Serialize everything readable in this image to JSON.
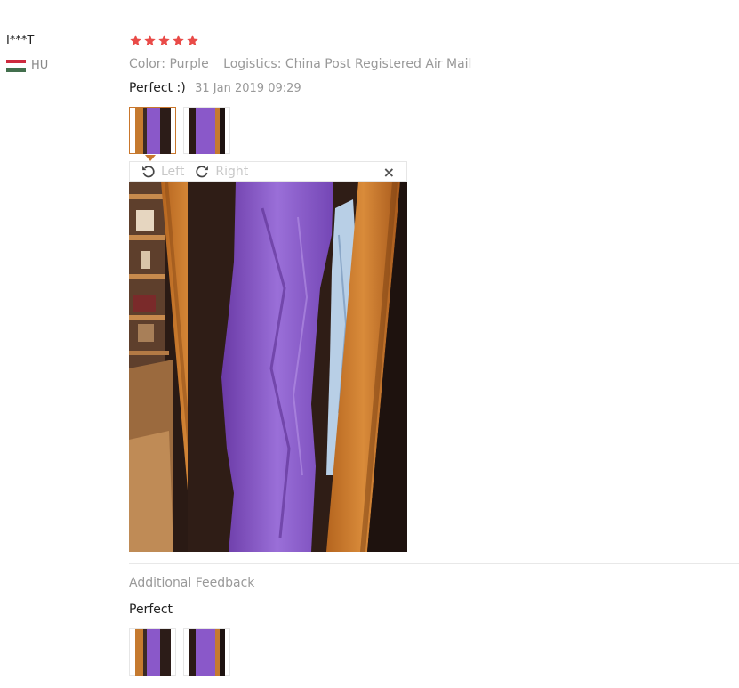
{
  "user": {
    "name": "I***T",
    "country": "HU",
    "flag_colors": [
      "#cd2a3e",
      "#ffffff",
      "#436f4d"
    ]
  },
  "rating": {
    "stars": 5,
    "color": "#e94b48"
  },
  "meta": {
    "color": "Color: Purple",
    "logistics": "Logistics: China Post Registered Air Mail"
  },
  "review": {
    "text": "Perfect :)",
    "date": "31 Jan 2019 09:29"
  },
  "viewer": {
    "rotate_left": "Left",
    "rotate_right": "Right",
    "close": "×"
  },
  "additional": {
    "title": "Additional Feedback",
    "text": "Perfect"
  },
  "colors": {
    "accent": "#c9772d",
    "muted": "#999999"
  }
}
